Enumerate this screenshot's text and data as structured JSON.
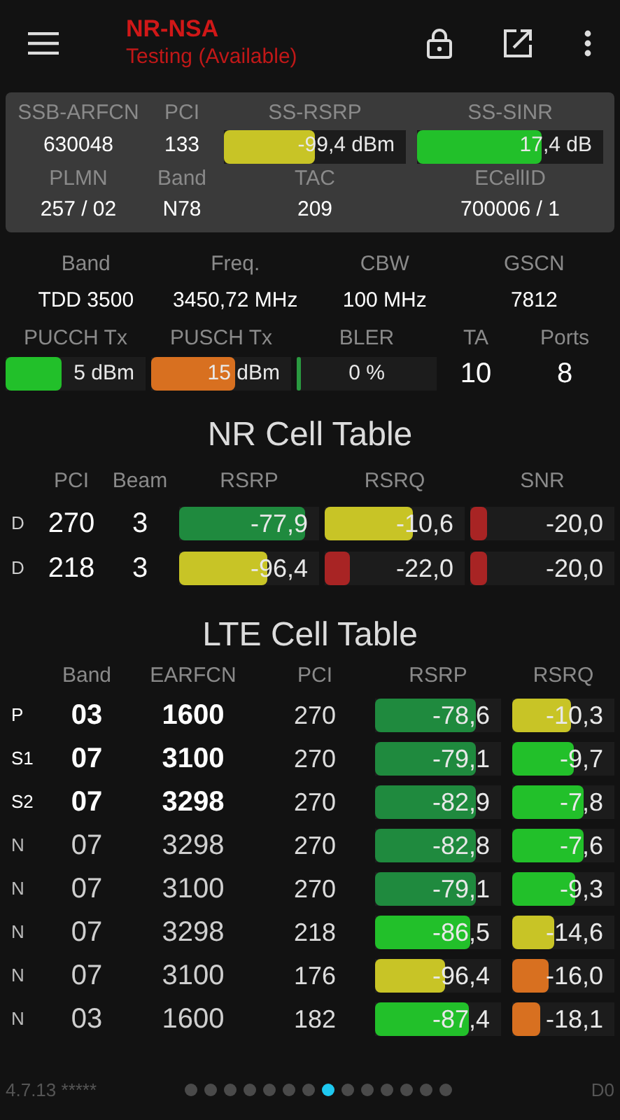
{
  "app_bar": {
    "title": "NR-NSA",
    "subtitle": "Testing (Available)"
  },
  "nr_panel": {
    "headers": [
      "SSB-ARFCN",
      "PCI",
      "SS-RSRP",
      "SS-SINR"
    ],
    "arfcn": "630048",
    "pci": "133",
    "rsrp": {
      "text": "-99,4 dBm",
      "level": 0.5,
      "color": "#c8c426"
    },
    "sinr": {
      "text": "17,4 dB",
      "level": 0.67,
      "color": "#22c02a"
    },
    "headers2": [
      "PLMN",
      "Band",
      "TAC",
      "ECellID"
    ],
    "values2": [
      "257 / 02",
      "N78",
      "209",
      "700006 / 1"
    ]
  },
  "info": {
    "headers": [
      "Band",
      "Freq.",
      "CBW",
      "GSCN"
    ],
    "values": [
      "TDD 3500",
      "3450,72 MHz",
      "100 MHz",
      "7812"
    ],
    "headers2": [
      "PUCCH Tx",
      "PUSCH Tx",
      "BLER",
      "TA",
      "Ports"
    ],
    "pucch": {
      "text": "5 dBm",
      "level": 0.4,
      "color": "#22c02a"
    },
    "pusch": {
      "text": "15 dBm",
      "level": 0.6,
      "color": "#d87020"
    },
    "bler": {
      "text": "0 %",
      "level": 0.03,
      "color": "#2a9a40"
    },
    "ta": "10",
    "ports": "8"
  },
  "nr_table": {
    "title": "NR Cell Table",
    "columns": [
      "PCI",
      "Beam",
      "RSRP",
      "RSRQ",
      "SNR"
    ],
    "rows": [
      {
        "tag": "D",
        "pci": "270",
        "beam": "3",
        "rsrp": {
          "text": "-77,9",
          "level": 0.9,
          "color": "#1f8a3e"
        },
        "rsrq": {
          "text": "-10,6",
          "level": 0.63,
          "color": "#c8c426"
        },
        "snr": {
          "text": "-20,0",
          "level": 0.12,
          "color": "#a82424"
        }
      },
      {
        "tag": "D",
        "pci": "218",
        "beam": "3",
        "rsrp": {
          "text": "-96,4",
          "level": 0.63,
          "color": "#c8c426"
        },
        "rsrq": {
          "text": "-22,0",
          "level": 0.18,
          "color": "#a82424"
        },
        "snr": {
          "text": "-20,0",
          "level": 0.12,
          "color": "#a82424"
        }
      }
    ]
  },
  "lte_table": {
    "title": "LTE Cell Table",
    "columns": [
      "Band",
      "EARFCN",
      "PCI",
      "RSRP",
      "RSRQ"
    ],
    "rows": [
      {
        "tag": "P",
        "serving": true,
        "band": "03",
        "earfcn": "1600",
        "pci": "270",
        "rsrp": {
          "text": "-78,6",
          "level": 0.8,
          "color": "#1f8a3e"
        },
        "rsrq": {
          "text": "-10,3",
          "level": 0.58,
          "color": "#c8c426"
        }
      },
      {
        "tag": "S1",
        "serving": true,
        "band": "07",
        "earfcn": "3100",
        "pci": "270",
        "rsrp": {
          "text": "-79,1",
          "level": 0.8,
          "color": "#1f8a3e"
        },
        "rsrq": {
          "text": "-9,7",
          "level": 0.6,
          "color": "#22c02a"
        }
      },
      {
        "tag": "S2",
        "serving": true,
        "band": "07",
        "earfcn": "3298",
        "pci": "270",
        "rsrp": {
          "text": "-82,9",
          "level": 0.8,
          "color": "#1f8a3e"
        },
        "rsrq": {
          "text": "-7,8",
          "level": 0.7,
          "color": "#22c02a"
        }
      },
      {
        "tag": "N",
        "serving": false,
        "band": "07",
        "earfcn": "3298",
        "pci": "270",
        "rsrp": {
          "text": "-82,8",
          "level": 0.8,
          "color": "#1f8a3e"
        },
        "rsrq": {
          "text": "-7,6",
          "level": 0.7,
          "color": "#22c02a"
        }
      },
      {
        "tag": "N",
        "serving": false,
        "band": "07",
        "earfcn": "3100",
        "pci": "270",
        "rsrp": {
          "text": "-79,1",
          "level": 0.8,
          "color": "#1f8a3e"
        },
        "rsrq": {
          "text": "-9,3",
          "level": 0.62,
          "color": "#22c02a"
        }
      },
      {
        "tag": "N",
        "serving": false,
        "band": "07",
        "earfcn": "3298",
        "pci": "218",
        "rsrp": {
          "text": "-86,5",
          "level": 0.76,
          "color": "#22c02a"
        },
        "rsrq": {
          "text": "-14,6",
          "level": 0.41,
          "color": "#c8c426"
        }
      },
      {
        "tag": "N",
        "serving": false,
        "band": "07",
        "earfcn": "3100",
        "pci": "176",
        "rsrp": {
          "text": "-96,4",
          "level": 0.56,
          "color": "#c8c426"
        },
        "rsrq": {
          "text": "-16,0",
          "level": 0.35,
          "color": "#d87020"
        }
      },
      {
        "tag": "N",
        "serving": false,
        "band": "03",
        "earfcn": "1600",
        "pci": "182",
        "rsrp": {
          "text": "-87,4",
          "level": 0.74,
          "color": "#22c02a"
        },
        "rsrq": {
          "text": "-18,1",
          "level": 0.27,
          "color": "#d87020"
        }
      }
    ]
  },
  "footer": {
    "version": "4.7.13 *****",
    "end_text": "D0",
    "pages": [
      {
        "selected": false
      },
      {
        "selected": false
      },
      {
        "selected": false
      },
      {
        "selected": false
      },
      {
        "selected": false
      },
      {
        "selected": false
      },
      {
        "selected": false
      },
      {
        "selected": true
      },
      {
        "selected": false
      },
      {
        "selected": false
      },
      {
        "selected": false
      },
      {
        "selected": false
      },
      {
        "selected": false
      },
      {
        "selected": false
      }
    ]
  }
}
